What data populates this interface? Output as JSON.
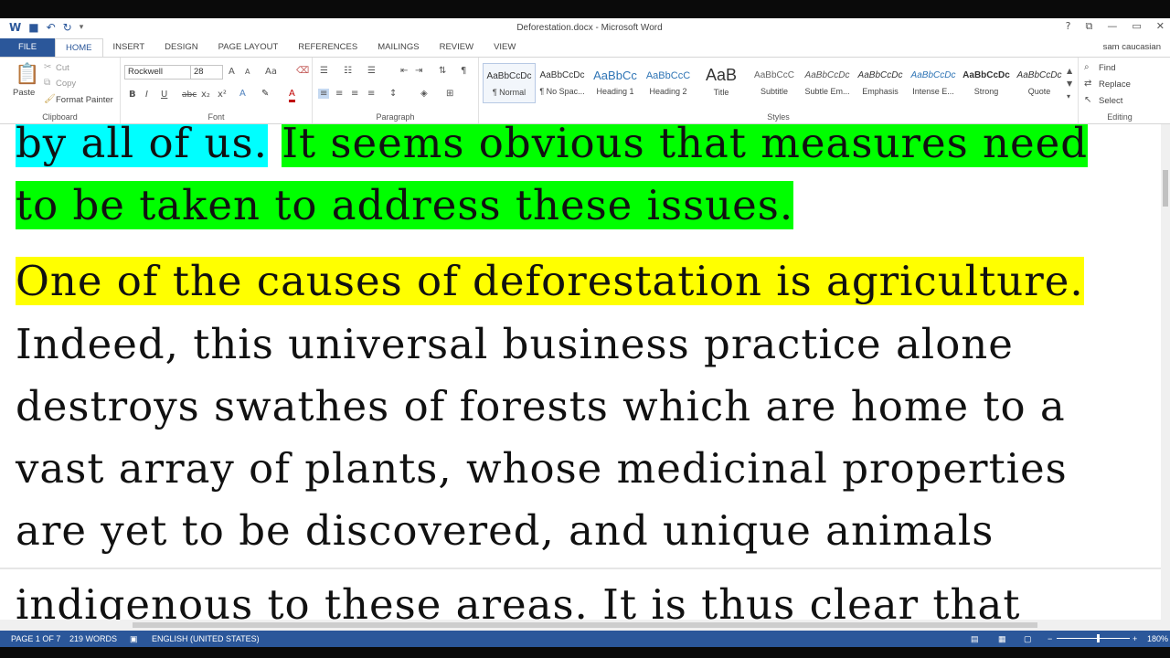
{
  "title_bar": {
    "document_title": "Deforestation.docx - Microsoft Word",
    "help": "?",
    "minimize": "—",
    "restore": "▭",
    "close": "✕"
  },
  "tabs": [
    "FILE",
    "HOME",
    "INSERT",
    "DESIGN",
    "PAGE LAYOUT",
    "REFERENCES",
    "MAILINGS",
    "REVIEW",
    "VIEW"
  ],
  "user": {
    "name": "sam caucasian"
  },
  "clipboard": {
    "label": "Clipboard",
    "paste": "Paste",
    "cut": "Cut",
    "copy": "Copy",
    "format_painter": "Format Painter"
  },
  "font": {
    "label": "Font",
    "family": "Rockwell",
    "size": "28",
    "grow": "A",
    "shrink": "A",
    "change_case": "Aa",
    "bold": "B",
    "italic": "I",
    "underline": "U",
    "strike": "abc",
    "subscript": "x₂",
    "superscript": "x²",
    "font_color": "A"
  },
  "paragraph": {
    "label": "Paragraph",
    "show_marks": "¶"
  },
  "styles": {
    "label": "Styles",
    "items": [
      {
        "sample": "AaBbCcDc",
        "name": "¶ Normal"
      },
      {
        "sample": "AaBbCcDc",
        "name": "¶ No Spac..."
      },
      {
        "sample": "AaBbCc",
        "name": "Heading 1"
      },
      {
        "sample": "AaBbCcC",
        "name": "Heading 2"
      },
      {
        "sample": "AaB",
        "name": "Title"
      },
      {
        "sample": "AaBbCcC",
        "name": "Subtitle"
      },
      {
        "sample": "AaBbCcDc",
        "name": "Subtle Em..."
      },
      {
        "sample": "AaBbCcDc",
        "name": "Emphasis"
      },
      {
        "sample": "AaBbCcDc",
        "name": "Intense E..."
      },
      {
        "sample": "AaBbCcDc",
        "name": "Strong"
      },
      {
        "sample": "AaBbCcDc",
        "name": "Quote"
      }
    ]
  },
  "editing": {
    "label": "Editing",
    "find": "Find",
    "replace": "Replace",
    "select": "Select"
  },
  "document": {
    "line1_cyan": "by all of us.",
    "line1_green": "It seems obvious that measures need",
    "line2_green": "to be taken to address these issues.",
    "line3_yellow": "One of the causes of deforestation is agriculture.",
    "line4": "Indeed, this universal business practice alone",
    "line5": "destroys swathes of forests which are home to a",
    "line6": "vast array of plants, whose medicinal properties",
    "line7": "are yet to be discovered, and unique animals",
    "line8": "indigenous to these areas. It is thus clear that"
  },
  "status_bar": {
    "page": "PAGE 1 OF 7",
    "words": "219 WORDS",
    "language": "ENGLISH (UNITED STATES)",
    "zoom": "180%"
  },
  "colors": {
    "accent": "#2b579a",
    "highlight_cyan": "#00ffff",
    "highlight_green": "#00ff00",
    "highlight_yellow": "#ffff00"
  }
}
